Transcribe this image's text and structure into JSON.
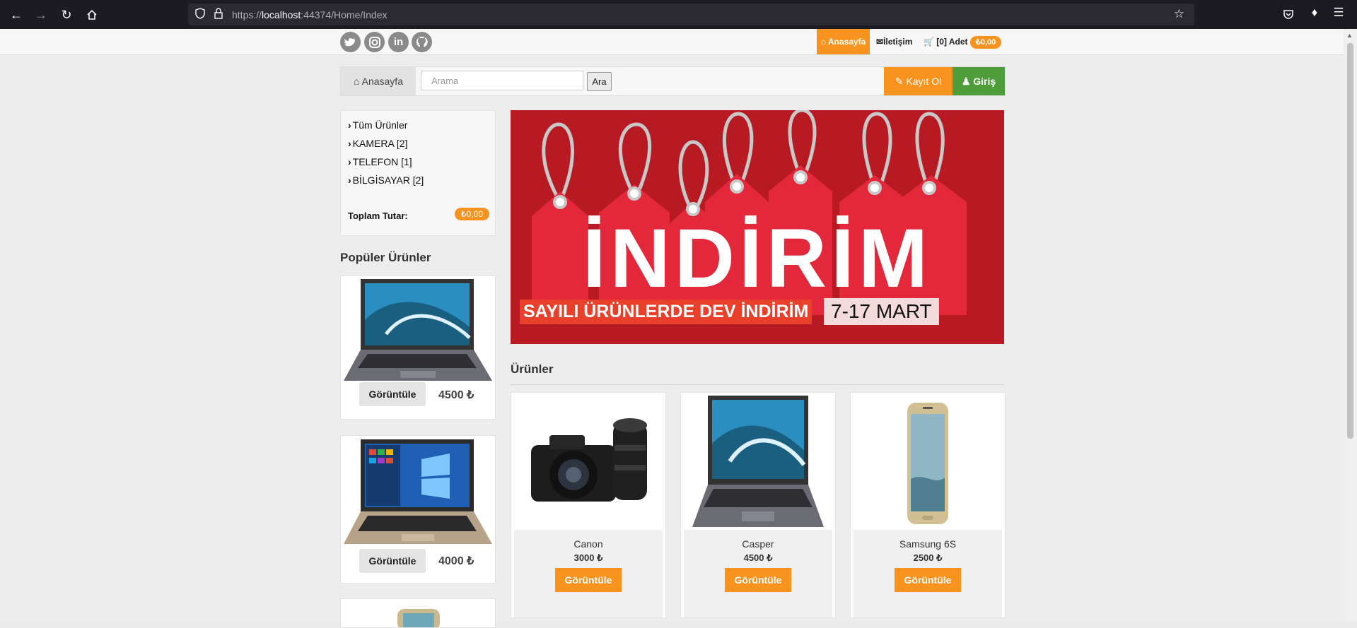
{
  "browser": {
    "url_prefix": "https://",
    "url_host": "localhost",
    "url_rest": ":44374/Home/Index",
    "icons": [
      "back-icon",
      "forward-icon",
      "reload-icon",
      "home-icon",
      "shield-icon",
      "lock-icon",
      "star-icon",
      "pocket-icon",
      "extensions-icon",
      "menu-icon"
    ]
  },
  "topbar": {
    "social": [
      "twitter-icon",
      "instagram-icon",
      "linkedin-icon",
      "github-icon"
    ],
    "nav_home": "Anasayfa",
    "nav_contact": "İletişim",
    "nav_cart": "[0] Adet",
    "cart_total": "₺0,00"
  },
  "searchbar": {
    "home_label": "Anasayfa",
    "search_placeholder": "Arama",
    "search_button": "Ara",
    "register_label": "Kayıt Ol",
    "login_label": "Giriş"
  },
  "sidebar": {
    "categories": [
      "Tüm Ürünler",
      "KAMERA [2]",
      "TELEFON [1]",
      "BİLGİSAYAR [2]"
    ],
    "total_label": "Toplam Tutar:",
    "total_value": "₺0,00"
  },
  "popular": {
    "title": "Popüler Ürünler",
    "items": [
      {
        "button": "Görüntüle",
        "price": "4500 ₺"
      },
      {
        "button": "Görüntüle",
        "price": "4000 ₺"
      }
    ]
  },
  "banner": {
    "headline": "İNDİRİM",
    "tagline": "SAYILI ÜRÜNLERDE DEV İNDİRİM",
    "date": "7-17 MART"
  },
  "products": {
    "title": "Ürünler",
    "items": [
      {
        "name": "Canon",
        "price": "3000 ₺",
        "button": "Görüntüle"
      },
      {
        "name": "Casper",
        "price": "4500 ₺",
        "button": "Görüntüle"
      },
      {
        "name": "Samsung 6S",
        "price": "2500 ₺",
        "button": "Görüntüle"
      }
    ]
  },
  "colors": {
    "accent": "#f7931e",
    "login": "#4f9d3a",
    "banner": "#b71a22"
  }
}
